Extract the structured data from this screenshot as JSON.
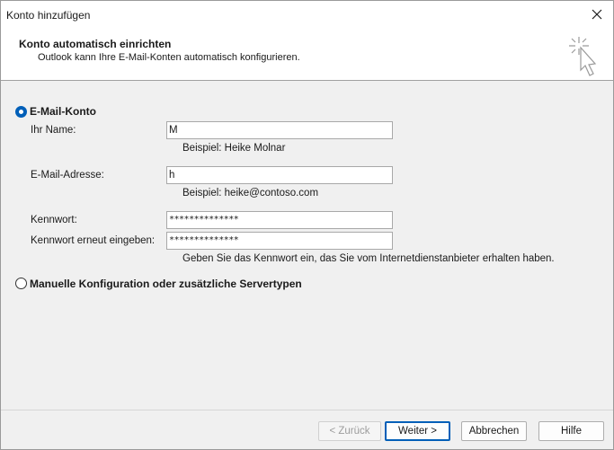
{
  "window": {
    "title": "Konto hinzufügen"
  },
  "header": {
    "title": "Konto automatisch einrichten",
    "subtitle": "Outlook kann Ihre E-Mail-Konten automatisch konfigurieren.",
    "icon": "cursor-sparkle-icon"
  },
  "email_account": {
    "option_label": "E-Mail-Konto",
    "selected": true,
    "name_label": "Ihr Name:",
    "name_value": "M",
    "name_hint": "Beispiel: Heike Molnar",
    "email_label": "E-Mail-Adresse:",
    "email_value": "h",
    "email_hint": "Beispiel: heike@contoso.com",
    "password_label": "Kennwort:",
    "password_value": "**************",
    "password_repeat_label": "Kennwort erneut eingeben:",
    "password_repeat_value": "**************",
    "password_hint": "Geben Sie das Kennwort ein, das Sie vom Internetdienstanbieter erhalten haben."
  },
  "manual": {
    "option_label": "Manuelle Konfiguration oder zusätzliche Servertypen",
    "selected": false
  },
  "buttons": {
    "back": "< Zurück",
    "next": "Weiter >",
    "cancel": "Abbrechen",
    "help": "Hilfe"
  },
  "colors": {
    "accent": "#005fb8"
  }
}
